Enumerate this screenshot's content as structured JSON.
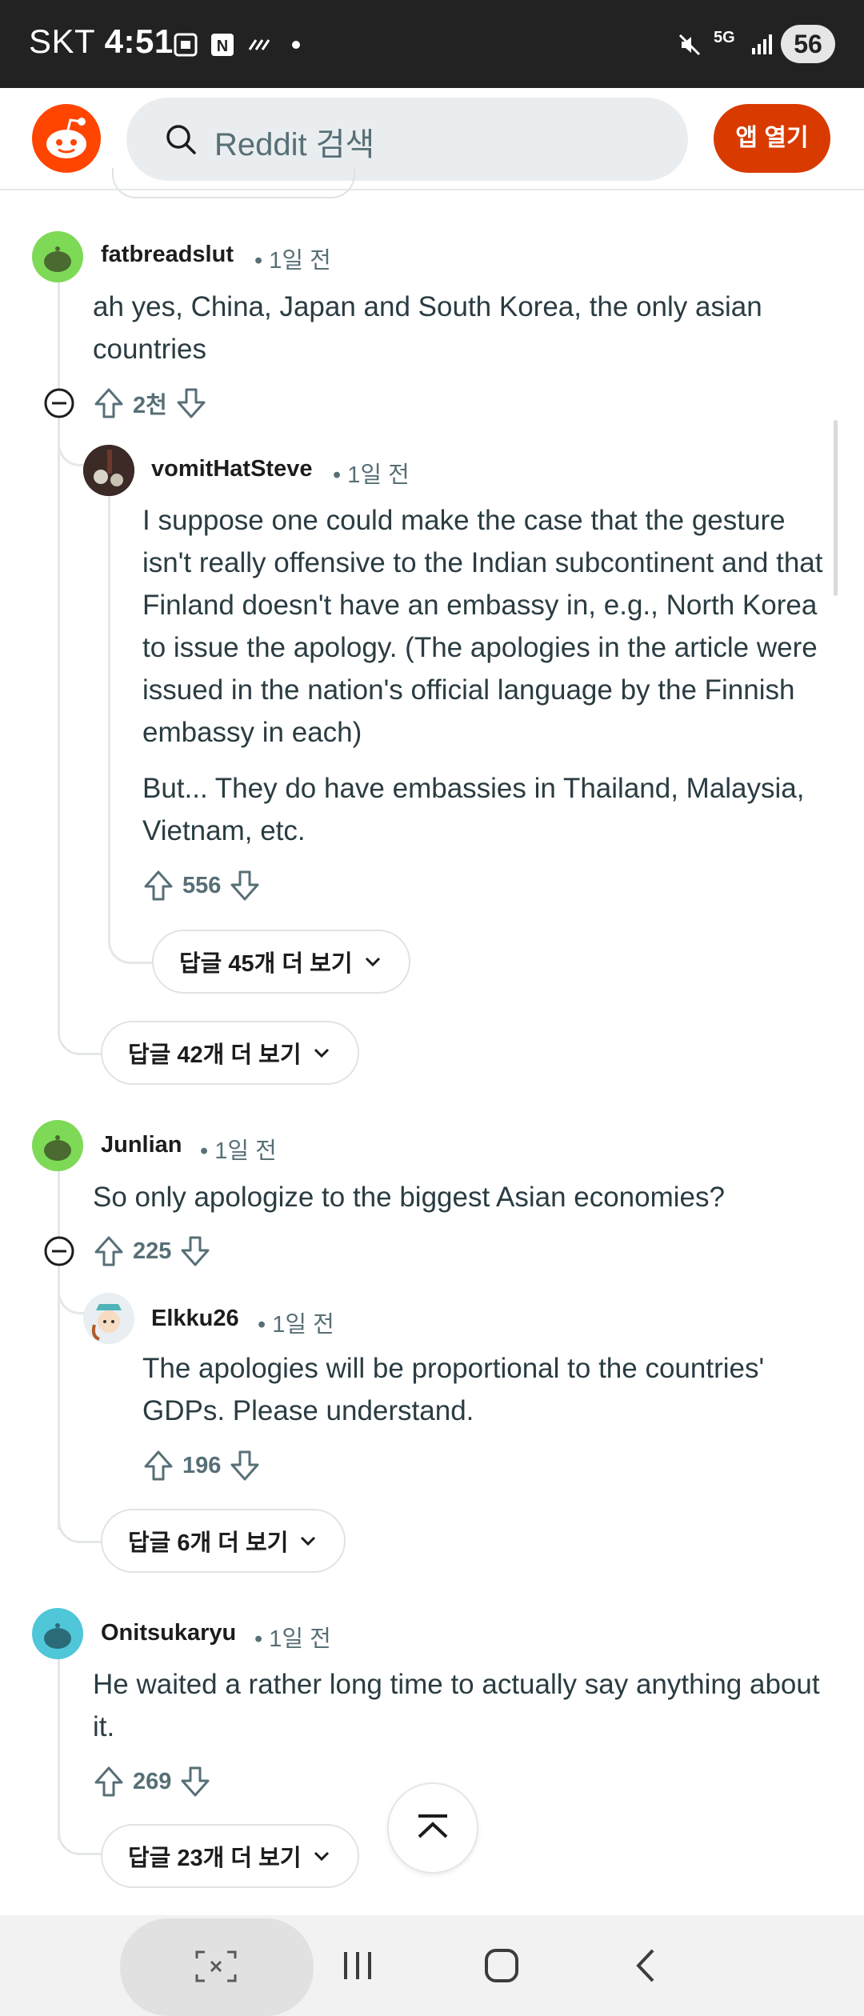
{
  "status_bar": {
    "carrier": "SKT",
    "time": "4:51",
    "network": "5G",
    "battery": "56",
    "icons": [
      "screenshot-icon",
      "naver-icon",
      "dnd-icon",
      "dot-icon",
      "mute-icon",
      "5g-icon",
      "signal-icon",
      "battery-icon"
    ]
  },
  "header": {
    "search_placeholder": "Reddit 검색",
    "open_app_label": "앱 열기"
  },
  "comments": [
    {
      "username": "fatbreadslut",
      "time": "• 1일 전",
      "body": [
        "ah yes, China, Japan and South Korea, the only asian countries"
      ],
      "votes": "2천"
    },
    {
      "username": "vomitHatSteve",
      "time": "• 1일 전",
      "body": [
        "I suppose one could make the case that the gesture isn't really offensive to the Indian subcontinent and that Finland doesn't have an embassy in, e.g., North Korea to issue the apology. (The apologies in the article were issued in the nation's official language by the Finnish embassy in each)",
        "But... They do have embassies in Thailand, Malaysia, Vietnam, etc."
      ],
      "votes": "556",
      "more_replies": "답글 45개 더 보기"
    },
    {
      "more_replies": "답글 42개 더 보기"
    },
    {
      "username": "Junlian",
      "time": "• 1일 전",
      "body": [
        "So only apologize to the biggest Asian economies?"
      ],
      "votes": "225"
    },
    {
      "username": "Elkku26",
      "time": "• 1일 전",
      "body": [
        "The apologies will be proportional to the countries' GDPs. Please understand."
      ],
      "votes": "196",
      "more_replies": "답글 6개 더 보기"
    },
    {
      "username": "Onitsukaryu",
      "time": "• 1일 전",
      "body": [
        "He waited a rather long time to actually say anything about it."
      ],
      "votes": "269",
      "more_replies": "답글 23개 더 보기"
    }
  ],
  "colors": {
    "reddit_orange": "#ff4500",
    "open_app_bg": "#d93a00",
    "snoo_green": "#7ed957",
    "snoo_teal": "#4fc7d8"
  }
}
